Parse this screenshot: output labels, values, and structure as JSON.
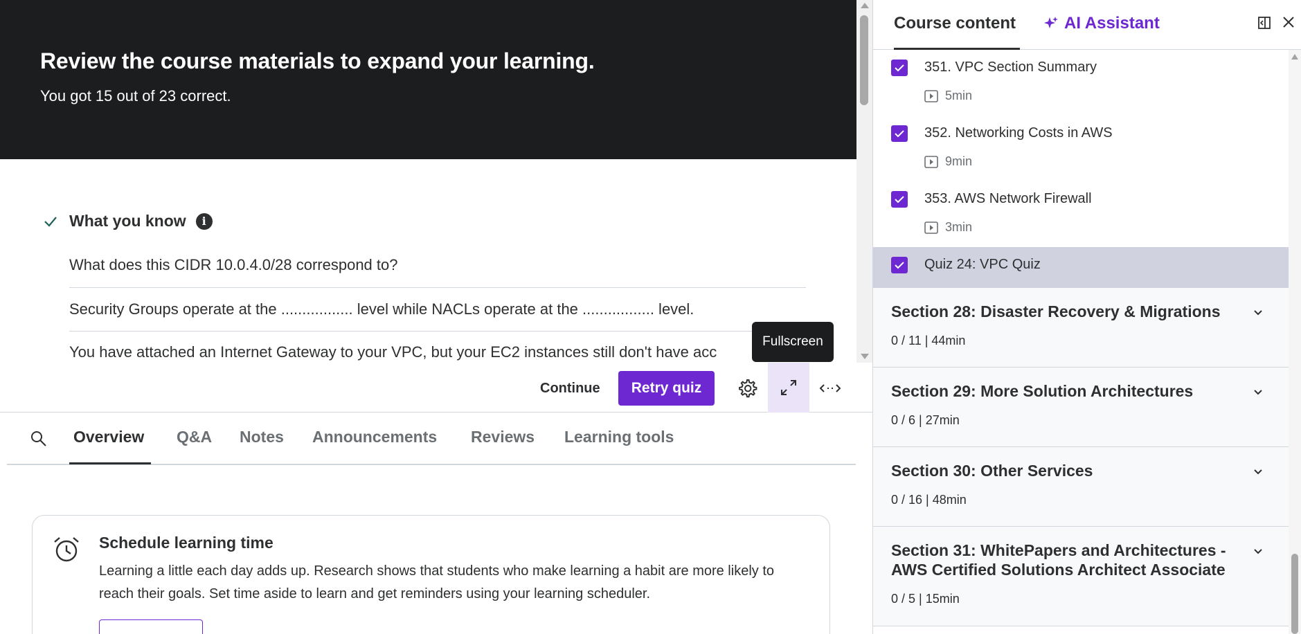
{
  "banner": {
    "title": "Review the course materials to expand your learning.",
    "subtitle": "You got 15 out of 23 correct."
  },
  "results": {
    "heading": "What you know",
    "questions": [
      "What does this CIDR 10.0.4.0/28 correspond to?",
      "Security Groups operate at the ................. level while NACLs operate at the ................. level.",
      "You have attached an Internet Gateway to your VPC, but your EC2 instances still don't have acc"
    ]
  },
  "controls": {
    "continue_label": "Continue",
    "retry_label": "Retry quiz",
    "tooltip": "Fullscreen"
  },
  "tabs": [
    "Overview",
    "Q&A",
    "Notes",
    "Announcements",
    "Reviews",
    "Learning tools"
  ],
  "schedule": {
    "title": "Schedule learning time",
    "text": "Learning a little each day adds up. Research shows that students who make learning a habit are more likely to reach their goals. Set time aside to learn and get reminders using your learning scheduler."
  },
  "sidebar": {
    "tab_course": "Course content",
    "tab_ai": "AI Assistant",
    "lectures": [
      {
        "title": "351. VPC Section Summary",
        "duration": "5min"
      },
      {
        "title": "352. Networking Costs in AWS",
        "duration": "9min"
      },
      {
        "title": "353. AWS Network Firewall",
        "duration": "3min"
      },
      {
        "title": "Quiz 24: VPC Quiz",
        "duration": ""
      }
    ],
    "sections": [
      {
        "title": "Section 28: Disaster Recovery & Migrations",
        "meta": "0 / 11 | 44min"
      },
      {
        "title": "Section 29: More Solution Architectures",
        "meta": "0 / 6 | 27min"
      },
      {
        "title": "Section 30: Other Services",
        "meta": "0 / 16 | 48min"
      },
      {
        "title": "Section 31: WhitePapers and Architectures - AWS Certified Solutions Architect Associate",
        "meta": "0 / 5 | 15min"
      }
    ]
  },
  "colors": {
    "accent": "#6d28d2",
    "banner_bg": "#1c1d1f",
    "current_row": "#d1d2e0"
  }
}
